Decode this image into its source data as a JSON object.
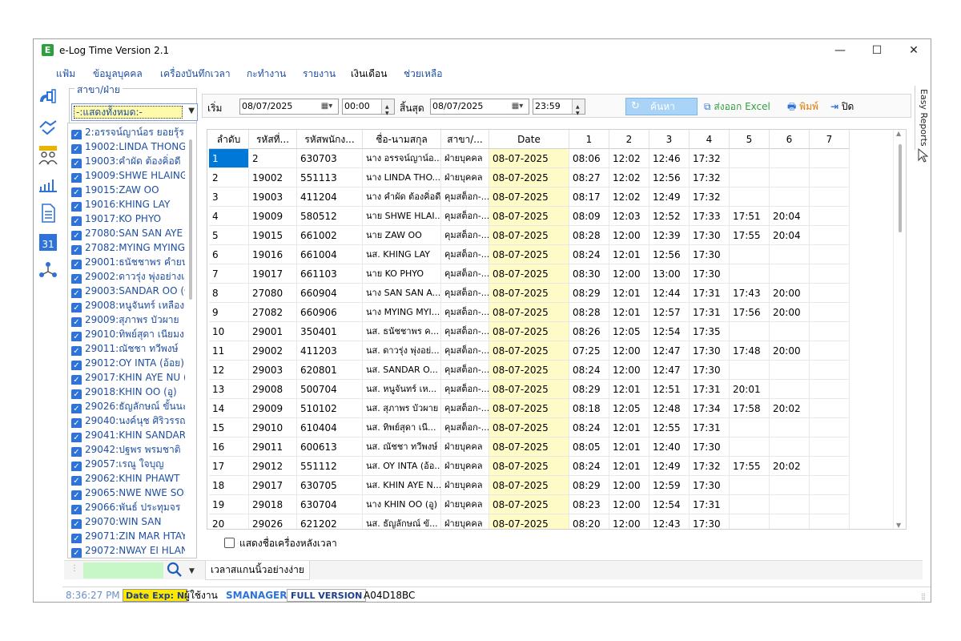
{
  "window": {
    "title": "e-Log Time Version 2.1",
    "icon_letter": "E",
    "minimize": "—",
    "maximize": "☐",
    "close": "✕"
  },
  "menu": [
    "แฟ้ม",
    "ข้อมูลบุคคล",
    "เครื่องบันทึกเวลา",
    "กะทำงาน",
    "รายงาน",
    "เงินเดือน",
    "ช่วยเหลือ"
  ],
  "branch": {
    "legend": "สาขา/ฝ่าย",
    "selected": "-:แสดงทั้งหมด:-"
  },
  "employees": [
    "2:อรรจน์ญาน์อร ยอยรุ้ร",
    "19002:LINDA THONGK",
    "19003:คำผัด ต้องคิ่อดี",
    "19009:SHWE HLAING",
    "19015:ZAW OO",
    "19016:KHING LAY",
    "19017:KO PHYO",
    "27080:SAN SAN AYE",
    "27082:MYING MYING",
    "29001:ธนัชชาพร คำยน",
    "29002:ดาวรุ่ง พุ่งอย่างเ",
    "29003:SANDAR OO (ข",
    "29008:หนูจันทร์ เหลือง",
    "29009:สุภาพร บัวผาย",
    "29010:ทิพย์สุดา เนียมง",
    "29011:ณัชชา ทวีพงษ์",
    "29012:OY INTA (อ้อย)",
    "29017:KHIN AYE NU (",
    "29018:KHIN OO (อู)",
    "29026:ธัญลักษณ์ ขั้นนะ",
    "29040:นงค์นุช ศิริวรรณ",
    "29041:KHIN SANDAR I",
    "29042:ปฐพร พรมชาติ",
    "29057:เรณู ใจบุญ",
    "29062:KHIN PHAWT",
    "29065:NWE NWE SOE",
    "29066:พันธ์ ประทุมจร",
    "29070:WIN SAN",
    "29071:ZIN MAR HTAY",
    "29072:NWAY EI HLAN"
  ],
  "toolbar": {
    "start_label": "เริ่ม",
    "start_date": "08/07/2025",
    "start_time": "00:00",
    "end_label": "สิ้นสุด",
    "end_date": "08/07/2025",
    "end_time": "23:59",
    "search_label": "ค้นหา",
    "export_label": "ส่งออก Excel",
    "print_label": "พิมพ์",
    "close_label": "ปิด"
  },
  "grid": {
    "columns": [
      "ลำดับ",
      "รหัสที่...",
      "รหัสพนักง...",
      "ชื่อ-นามสกุล",
      "สาขา/...",
      "Date",
      "1",
      "2",
      "3",
      "4",
      "5",
      "6",
      "7"
    ],
    "rows": [
      [
        "1",
        "2",
        "630703",
        "นาง อรรจน์ญาน์อ...",
        "ฝ่ายบุคคล",
        "08-07-2025",
        "08:06",
        "12:02",
        "12:46",
        "17:32",
        "",
        "",
        ""
      ],
      [
        "2",
        "19002",
        "551113",
        "นาง LINDA  THO...",
        "ฝ่ายบุคคล",
        "08-07-2025",
        "08:27",
        "12:02",
        "12:56",
        "17:32",
        "",
        "",
        ""
      ],
      [
        "3",
        "19003",
        "411204",
        "นาง คำผัด  ต้องคิ่อดี",
        "คุมสต็อก-...",
        "08-07-2025",
        "08:17",
        "12:02",
        "12:49",
        "17:32",
        "",
        "",
        ""
      ],
      [
        "4",
        "19009",
        "580512",
        "นาย SHWE HLAI...",
        "คุมสต็อก-...",
        "08-07-2025",
        "08:09",
        "12:03",
        "12:52",
        "17:33",
        "17:51",
        "20:04",
        ""
      ],
      [
        "5",
        "19015",
        "661002",
        "นาย ZAW OO",
        "คุมสต็อก-...",
        "08-07-2025",
        "08:28",
        "12:00",
        "12:39",
        "17:30",
        "17:55",
        "20:04",
        ""
      ],
      [
        "6",
        "19016",
        "661004",
        "นส. KHING LAY",
        "คุมสต็อก-...",
        "08-07-2025",
        "08:24",
        "12:01",
        "12:56",
        "17:30",
        "",
        "",
        ""
      ],
      [
        "7",
        "19017",
        "661103",
        "นาย KO PHYO",
        "คุมสต็อก-...",
        "08-07-2025",
        "08:30",
        "12:00",
        "13:00",
        "17:30",
        "",
        "",
        ""
      ],
      [
        "8",
        "27080",
        "660904",
        "นาง SAN SAN A...",
        "คุมสต็อก-...",
        "08-07-2025",
        "08:29",
        "12:01",
        "12:44",
        "17:31",
        "17:43",
        "20:00",
        ""
      ],
      [
        "9",
        "27082",
        "660906",
        "นาง MYING MYI...",
        "คุมสต็อก-...",
        "08-07-2025",
        "08:28",
        "12:01",
        "12:57",
        "17:31",
        "17:56",
        "20:00",
        ""
      ],
      [
        "10",
        "29001",
        "350401",
        "นส. ธนัชชาพร  ค...",
        "คุมสต็อก-...",
        "08-07-2025",
        "08:26",
        "12:05",
        "12:54",
        "17:35",
        "",
        "",
        ""
      ],
      [
        "11",
        "29002",
        "411203",
        "นส. ดาวรุ่ง  พุ่งอย่...",
        "คุมสต็อก-...",
        "08-07-2025",
        "07:25",
        "12:00",
        "12:47",
        "17:30",
        "17:48",
        "20:00",
        ""
      ],
      [
        "12",
        "29003",
        "620801",
        "นส. SANDAR O...",
        "คุมสต็อก-...",
        "08-07-2025",
        "08:24",
        "12:00",
        "12:47",
        "17:30",
        "",
        "",
        ""
      ],
      [
        "13",
        "29008",
        "500704",
        "นส. หนูจันทร์  เห...",
        "คุมสต็อก-...",
        "08-07-2025",
        "08:29",
        "12:01",
        "12:51",
        "17:31",
        "20:01",
        "",
        ""
      ],
      [
        "14",
        "29009",
        "510102",
        "นส. สุภาพร  บัวผาย",
        "คุมสต็อก-...",
        "08-07-2025",
        "08:18",
        "12:05",
        "12:48",
        "17:34",
        "17:58",
        "20:02",
        ""
      ],
      [
        "15",
        "29010",
        "610404",
        "นส. ทิพย์สุดา  เนี...",
        "คุมสต็อก-...",
        "08-07-2025",
        "08:24",
        "12:01",
        "12:55",
        "17:31",
        "",
        "",
        ""
      ],
      [
        "16",
        "29011",
        "600613",
        "นส. ณัชชา  ทวีพงษ์",
        "ฝ่ายบุคคล",
        "08-07-2025",
        "08:05",
        "12:01",
        "12:40",
        "17:30",
        "",
        "",
        ""
      ],
      [
        "17",
        "29012",
        "551112",
        "นส. OY INTA (อ้อ...",
        "ฝ่ายบุคคล",
        "08-07-2025",
        "08:24",
        "12:01",
        "12:49",
        "17:32",
        "17:55",
        "20:02",
        ""
      ],
      [
        "18",
        "29017",
        "630705",
        "นส. KHIN AYE N...",
        "ฝ่ายบุคคล",
        "08-07-2025",
        "08:29",
        "12:00",
        "12:59",
        "17:30",
        "",
        "",
        ""
      ],
      [
        "19",
        "29018",
        "630704",
        "นาง KHIN OO (อู)",
        "ฝ่ายบุคคล",
        "08-07-2025",
        "08:23",
        "12:00",
        "12:54",
        "17:31",
        "",
        "",
        ""
      ],
      [
        "20",
        "29026",
        "621202",
        "นส. ธัญลักษณ์  ขั...",
        "ฝ่ายบุคคล",
        "08-07-2025",
        "08:20",
        "12:00",
        "12:43",
        "17:30",
        "",
        "",
        ""
      ]
    ]
  },
  "options": {
    "show_device_name": "แสดงชื่อเครื่องหลังเวลา"
  },
  "tabs": [
    "เวลาสแกนนิ้วอย่างง่าย"
  ],
  "side_panel": {
    "easy_reports": "Easy Reports"
  },
  "status": {
    "time": "8:36:27 PM",
    "date_exp": "Date Exp: N",
    "user_label": "ผู้ใช้งาน",
    "user": "SMANAGER",
    "version": "FULL VERSION",
    "code": "A04D18BC"
  },
  "colors": {
    "accent": "#1f4fa0",
    "date_highlight": "#fffbc6",
    "selection": "#0078d7",
    "search_bg": "#a9d4f7",
    "check": "#2f73d9",
    "excel": "#2e9e3f",
    "print": "#e07a00",
    "date_exp_bg": "#ffe800"
  }
}
